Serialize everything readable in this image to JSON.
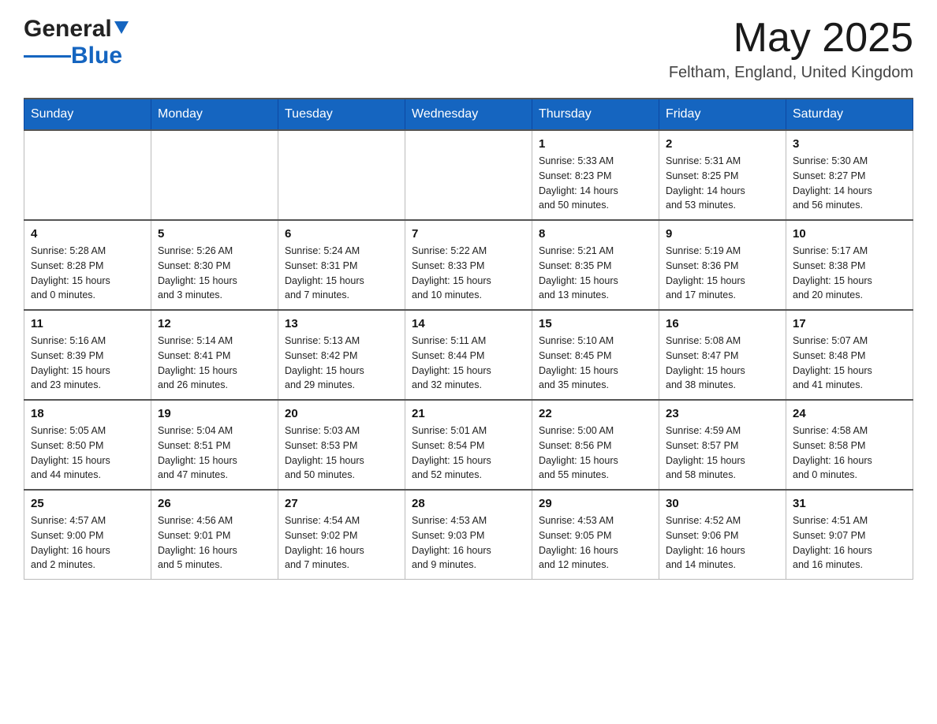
{
  "header": {
    "logo": {
      "general": "General",
      "blue": "Blue"
    },
    "month": "May 2025",
    "location": "Feltham, England, United Kingdom"
  },
  "weekdays": [
    "Sunday",
    "Monday",
    "Tuesday",
    "Wednesday",
    "Thursday",
    "Friday",
    "Saturday"
  ],
  "weeks": [
    [
      {
        "day": "",
        "info": ""
      },
      {
        "day": "",
        "info": ""
      },
      {
        "day": "",
        "info": ""
      },
      {
        "day": "",
        "info": ""
      },
      {
        "day": "1",
        "info": "Sunrise: 5:33 AM\nSunset: 8:23 PM\nDaylight: 14 hours\nand 50 minutes."
      },
      {
        "day": "2",
        "info": "Sunrise: 5:31 AM\nSunset: 8:25 PM\nDaylight: 14 hours\nand 53 minutes."
      },
      {
        "day": "3",
        "info": "Sunrise: 5:30 AM\nSunset: 8:27 PM\nDaylight: 14 hours\nand 56 minutes."
      }
    ],
    [
      {
        "day": "4",
        "info": "Sunrise: 5:28 AM\nSunset: 8:28 PM\nDaylight: 15 hours\nand 0 minutes."
      },
      {
        "day": "5",
        "info": "Sunrise: 5:26 AM\nSunset: 8:30 PM\nDaylight: 15 hours\nand 3 minutes."
      },
      {
        "day": "6",
        "info": "Sunrise: 5:24 AM\nSunset: 8:31 PM\nDaylight: 15 hours\nand 7 minutes."
      },
      {
        "day": "7",
        "info": "Sunrise: 5:22 AM\nSunset: 8:33 PM\nDaylight: 15 hours\nand 10 minutes."
      },
      {
        "day": "8",
        "info": "Sunrise: 5:21 AM\nSunset: 8:35 PM\nDaylight: 15 hours\nand 13 minutes."
      },
      {
        "day": "9",
        "info": "Sunrise: 5:19 AM\nSunset: 8:36 PM\nDaylight: 15 hours\nand 17 minutes."
      },
      {
        "day": "10",
        "info": "Sunrise: 5:17 AM\nSunset: 8:38 PM\nDaylight: 15 hours\nand 20 minutes."
      }
    ],
    [
      {
        "day": "11",
        "info": "Sunrise: 5:16 AM\nSunset: 8:39 PM\nDaylight: 15 hours\nand 23 minutes."
      },
      {
        "day": "12",
        "info": "Sunrise: 5:14 AM\nSunset: 8:41 PM\nDaylight: 15 hours\nand 26 minutes."
      },
      {
        "day": "13",
        "info": "Sunrise: 5:13 AM\nSunset: 8:42 PM\nDaylight: 15 hours\nand 29 minutes."
      },
      {
        "day": "14",
        "info": "Sunrise: 5:11 AM\nSunset: 8:44 PM\nDaylight: 15 hours\nand 32 minutes."
      },
      {
        "day": "15",
        "info": "Sunrise: 5:10 AM\nSunset: 8:45 PM\nDaylight: 15 hours\nand 35 minutes."
      },
      {
        "day": "16",
        "info": "Sunrise: 5:08 AM\nSunset: 8:47 PM\nDaylight: 15 hours\nand 38 minutes."
      },
      {
        "day": "17",
        "info": "Sunrise: 5:07 AM\nSunset: 8:48 PM\nDaylight: 15 hours\nand 41 minutes."
      }
    ],
    [
      {
        "day": "18",
        "info": "Sunrise: 5:05 AM\nSunset: 8:50 PM\nDaylight: 15 hours\nand 44 minutes."
      },
      {
        "day": "19",
        "info": "Sunrise: 5:04 AM\nSunset: 8:51 PM\nDaylight: 15 hours\nand 47 minutes."
      },
      {
        "day": "20",
        "info": "Sunrise: 5:03 AM\nSunset: 8:53 PM\nDaylight: 15 hours\nand 50 minutes."
      },
      {
        "day": "21",
        "info": "Sunrise: 5:01 AM\nSunset: 8:54 PM\nDaylight: 15 hours\nand 52 minutes."
      },
      {
        "day": "22",
        "info": "Sunrise: 5:00 AM\nSunset: 8:56 PM\nDaylight: 15 hours\nand 55 minutes."
      },
      {
        "day": "23",
        "info": "Sunrise: 4:59 AM\nSunset: 8:57 PM\nDaylight: 15 hours\nand 58 minutes."
      },
      {
        "day": "24",
        "info": "Sunrise: 4:58 AM\nSunset: 8:58 PM\nDaylight: 16 hours\nand 0 minutes."
      }
    ],
    [
      {
        "day": "25",
        "info": "Sunrise: 4:57 AM\nSunset: 9:00 PM\nDaylight: 16 hours\nand 2 minutes."
      },
      {
        "day": "26",
        "info": "Sunrise: 4:56 AM\nSunset: 9:01 PM\nDaylight: 16 hours\nand 5 minutes."
      },
      {
        "day": "27",
        "info": "Sunrise: 4:54 AM\nSunset: 9:02 PM\nDaylight: 16 hours\nand 7 minutes."
      },
      {
        "day": "28",
        "info": "Sunrise: 4:53 AM\nSunset: 9:03 PM\nDaylight: 16 hours\nand 9 minutes."
      },
      {
        "day": "29",
        "info": "Sunrise: 4:53 AM\nSunset: 9:05 PM\nDaylight: 16 hours\nand 12 minutes."
      },
      {
        "day": "30",
        "info": "Sunrise: 4:52 AM\nSunset: 9:06 PM\nDaylight: 16 hours\nand 14 minutes."
      },
      {
        "day": "31",
        "info": "Sunrise: 4:51 AM\nSunset: 9:07 PM\nDaylight: 16 hours\nand 16 minutes."
      }
    ]
  ]
}
